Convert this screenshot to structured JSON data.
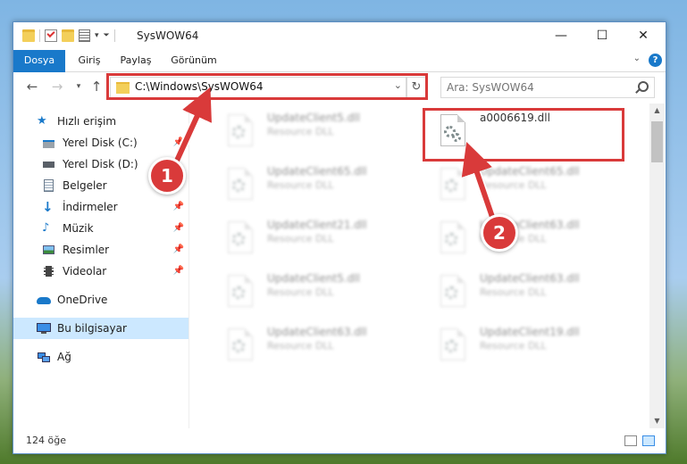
{
  "window": {
    "title": "SysWOW64"
  },
  "ribbon": {
    "tabs": [
      "Dosya",
      "Giriş",
      "Paylaş",
      "Görünüm"
    ],
    "help": "?"
  },
  "address": {
    "path": "C:\\Windows\\SysWOW64"
  },
  "search": {
    "placeholder": "Ara: SysWOW64"
  },
  "sidebar": {
    "items": [
      {
        "label": "Hızlı erişim",
        "icon": "star-icon"
      },
      {
        "label": "Yerel Disk (C:)",
        "icon": "drive-icon"
      },
      {
        "label": "Yerel Disk (D:)",
        "icon": "drive-icon"
      },
      {
        "label": "Belgeler",
        "icon": "documents-icon"
      },
      {
        "label": "İndirmeler",
        "icon": "download-icon"
      },
      {
        "label": "Müzik",
        "icon": "music-icon"
      },
      {
        "label": "Resimler",
        "icon": "pictures-icon"
      },
      {
        "label": "Videolar",
        "icon": "video-icon"
      },
      {
        "label": "OneDrive",
        "icon": "cloud-icon"
      },
      {
        "label": "Bu bilgisayar",
        "icon": "computer-icon"
      },
      {
        "label": "Ağ",
        "icon": "network-icon"
      }
    ]
  },
  "files": [
    {
      "name": "UpdateClient5.dll",
      "type": "Resource DLL"
    },
    {
      "name": "a0006619.dll",
      "type": ""
    },
    {
      "name": "UpdateClient65.dll",
      "type": "Resource DLL"
    },
    {
      "name": "UpdateClient65.dll",
      "type": "Resource DLL"
    },
    {
      "name": "UpdateClient21.dll",
      "type": "Resource DLL"
    },
    {
      "name": "UpdateClient63.dll",
      "type": "Resource DLL"
    },
    {
      "name": "UpdateClient5.dll",
      "type": "Resource DLL"
    },
    {
      "name": "UpdateClient63.dll",
      "type": "Resource DLL"
    },
    {
      "name": "UpdateClient63.dll",
      "type": "Resource DLL"
    },
    {
      "name": "UpdateClient19.dll",
      "type": "Resource DLL"
    }
  ],
  "status": {
    "count": "124 öğe"
  },
  "callouts": [
    "1",
    "2"
  ],
  "colors": {
    "accent": "#1979ca",
    "highlight": "#d93a3a",
    "selection": "#cce8ff"
  }
}
